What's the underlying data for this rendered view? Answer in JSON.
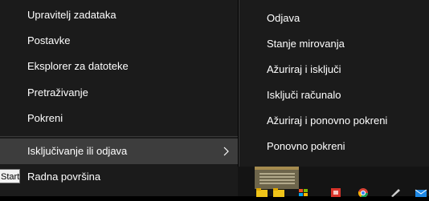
{
  "main_menu": {
    "items": [
      {
        "label": "Upravitelj zadataka"
      },
      {
        "label": "Postavke"
      },
      {
        "label": "Eksplorer za datoteke"
      },
      {
        "label": "Pretraživanje"
      },
      {
        "label": "Pokreni"
      },
      {
        "label": "Isključivanje ili odjava"
      },
      {
        "label": "Radna površina"
      }
    ],
    "tooltip": "Start"
  },
  "submenu": {
    "items": [
      {
        "label": "Odjava"
      },
      {
        "label": "Stanje mirovanja"
      },
      {
        "label": "Ažuriraj i isključi"
      },
      {
        "label": "Isključi računalo"
      },
      {
        "label": "Ažuriraj i ponovno pokreni"
      },
      {
        "label": "Ponovno pokreni"
      }
    ]
  },
  "colors": {
    "menu_bg": "#1b1b1b",
    "highlight_bg": "#3d3d3d",
    "taskbar_bg": "#141414"
  },
  "taskbar_icons": [
    "folder-icon",
    "folder-icon",
    "store-icon",
    "generic-app-icon",
    "chrome-icon",
    "pen-icon",
    "mail-icon"
  ]
}
